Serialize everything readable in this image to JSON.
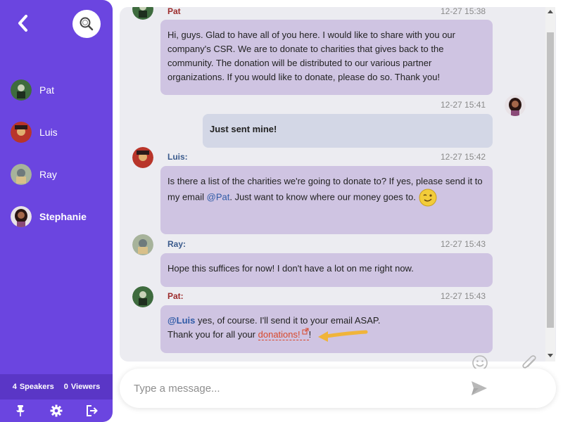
{
  "sidebar": {
    "users": [
      {
        "name": "Pat",
        "avatar_color": "#3e6b3e"
      },
      {
        "name": "Luis",
        "avatar_color": "#b8352a"
      },
      {
        "name": "Ray",
        "avatar_color": "#a7b39b"
      },
      {
        "name": "Stephanie",
        "avatar_color": "#4a2f2a"
      }
    ],
    "stats": {
      "speakers_count": "4",
      "speakers_label": "Speakers",
      "viewers_count": "0",
      "viewers_label": "Viewers"
    },
    "accent": "#6b45e0"
  },
  "chat": {
    "messages": [
      {
        "sender": "Pat",
        "time": "12-27 15:38",
        "text": "Hi, guys. Glad to have all of you here. I would like to share with you our company's CSR. We are to donate to charities that gives back to the community. The donation will be distributed to our various partner organizations. If you would like to donate, please do so. Thank you!"
      },
      {
        "sender": "",
        "time": "12-27 15:41",
        "text": "Just sent mine!"
      },
      {
        "sender": "Luis:",
        "time": "12-27 15:42",
        "text_part1": "Is there a list of the charities we're going to donate to? If yes, please send it to my email ",
        "mention": "@Pat",
        "text_part2": ". Just want to know where our money goes to."
      },
      {
        "sender": "Ray:",
        "time": "12-27 15:43",
        "text": "Hope this suffices for now! I don't have a lot on me right now."
      },
      {
        "sender": "Pat:",
        "time": "12-27 15:43",
        "mention": "@Luis",
        "text_part1": " yes, of course. I'll send it to your email ASAP.",
        "text_part2": "Thank you for all your ",
        "link": "donations!",
        "text_part3": "!"
      }
    ]
  },
  "composer": {
    "placeholder": "Type a message..."
  }
}
